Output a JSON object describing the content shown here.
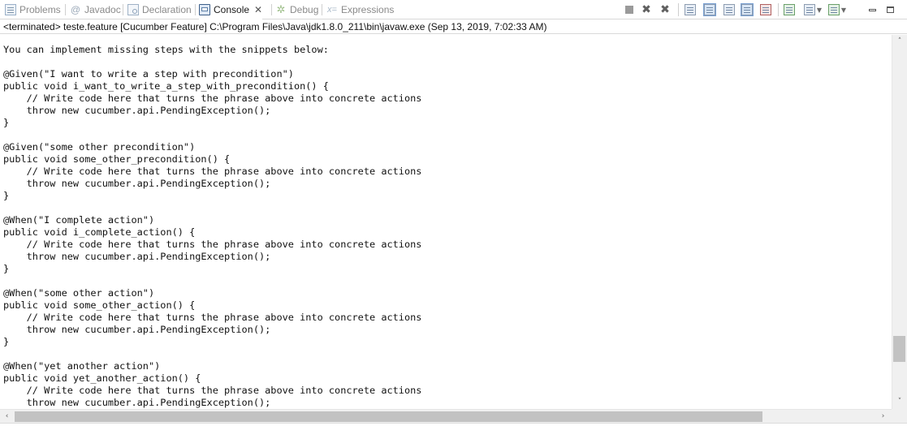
{
  "tabs": [
    {
      "label": "Problems",
      "icon": "problems-icon",
      "active": false
    },
    {
      "label": "Javadoc",
      "icon": "javadoc-icon",
      "active": false
    },
    {
      "label": "Declaration",
      "icon": "declaration-icon",
      "active": false
    },
    {
      "label": "Console",
      "icon": "console-icon",
      "active": true,
      "close": "✕"
    },
    {
      "label": "Debug",
      "icon": "debug-icon",
      "active": false
    },
    {
      "label": "Expressions",
      "icon": "expressions-icon",
      "active": false
    }
  ],
  "toolbar": {
    "icons": [
      "terminate-icon",
      "remove-launch-icon",
      "remove-all-terminated-icon",
      "scroll-lock-icon",
      "show-console-on-output-icon",
      "show-console-on-error-icon",
      "word-wrap-icon",
      "clear-console-icon",
      "pin-console-icon",
      "display-selected-console-icon",
      "open-console-icon",
      "minimize-icon",
      "maximize-icon"
    ]
  },
  "status": {
    "text": "<terminated> teste.feature [Cucumber Feature] C:\\Program Files\\Java\\jdk1.8.0_211\\bin\\javaw.exe (Sep 13, 2019, 7:02:33 AM)"
  },
  "console": {
    "text": "You can implement missing steps with the snippets below:\n\n@Given(\"I want to write a step with precondition\")\npublic void i_want_to_write_a_step_with_precondition() {\n    // Write code here that turns the phrase above into concrete actions\n    throw new cucumber.api.PendingException();\n}\n\n@Given(\"some other precondition\")\npublic void some_other_precondition() {\n    // Write code here that turns the phrase above into concrete actions\n    throw new cucumber.api.PendingException();\n}\n\n@When(\"I complete action\")\npublic void i_complete_action() {\n    // Write code here that turns the phrase above into concrete actions\n    throw new cucumber.api.PendingException();\n}\n\n@When(\"some other action\")\npublic void some_other_action() {\n    // Write code here that turns the phrase above into concrete actions\n    throw new cucumber.api.PendingException();\n}\n\n@When(\"yet another action\")\npublic void yet_another_action() {\n    // Write code here that turns the phrase above into concrete actions\n    throw new cucumber.api.PendingException();"
  },
  "scrollbars": {
    "up_arrow": "˄",
    "down_arrow": "˅",
    "left_arrow": "‹",
    "right_arrow": "›"
  }
}
